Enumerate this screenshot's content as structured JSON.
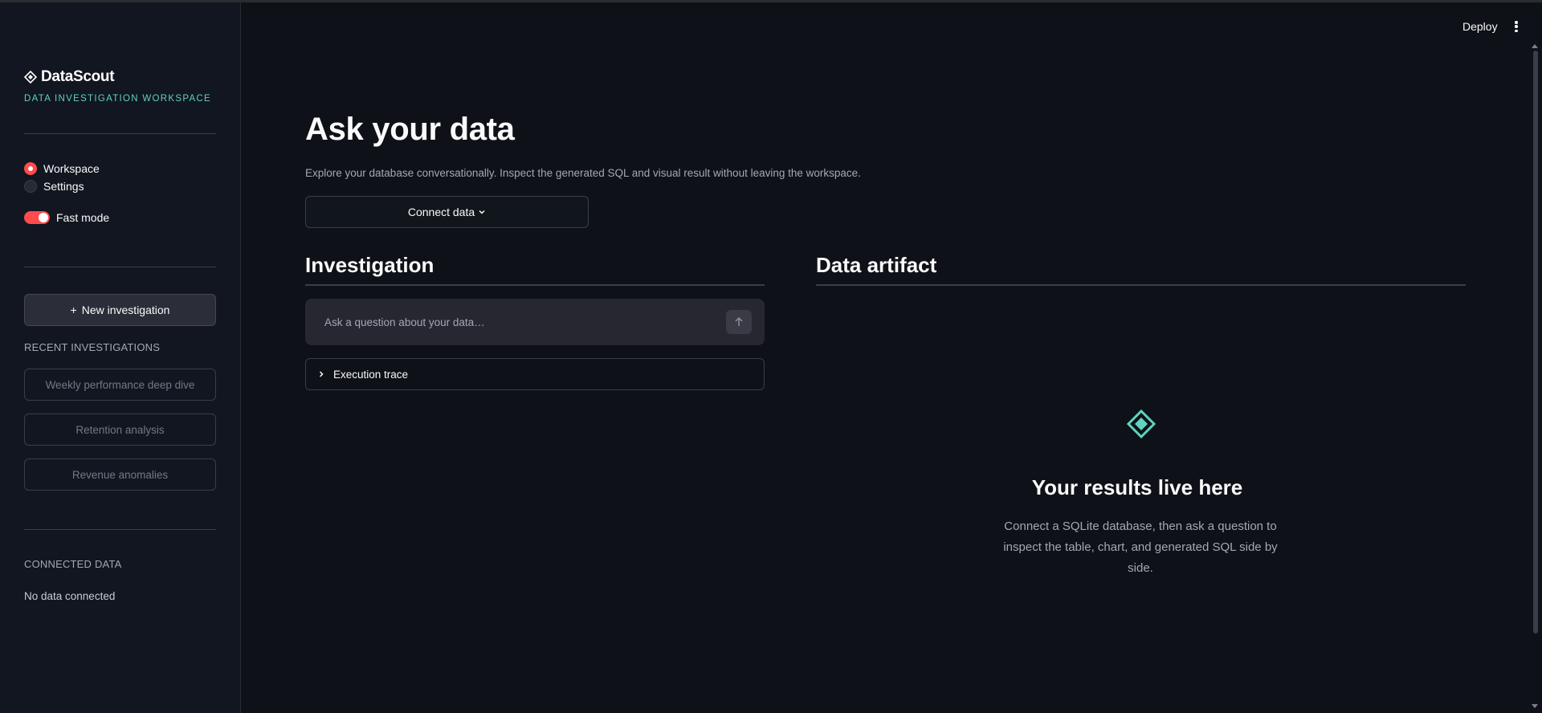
{
  "brand": {
    "name": "DataScout",
    "tagline": "DATA INVESTIGATION WORKSPACE",
    "icon": "diamond-logo-icon",
    "accent": "#5fd3bf"
  },
  "sidebar": {
    "nav": [
      {
        "label": "Workspace",
        "selected": true
      },
      {
        "label": "Settings",
        "selected": false
      }
    ],
    "fast_mode": {
      "label": "Fast mode",
      "on": true
    },
    "new_investigation": {
      "label": "New investigation",
      "icon": "plus"
    },
    "recent_label": "RECENT INVESTIGATIONS",
    "recent": [
      {
        "label": "Weekly performance deep dive"
      },
      {
        "label": "Retention analysis"
      },
      {
        "label": "Revenue anomalies"
      }
    ],
    "connected_label": "CONNECTED DATA",
    "connected_value": "No data connected"
  },
  "header": {
    "deploy_label": "Deploy",
    "menu_icon": "kebab-menu-icon"
  },
  "main": {
    "title": "Ask your data",
    "description": "Explore your database conversationally. Inspect the generated SQL and visual result without leaving the workspace.",
    "connect_button": "Connect data",
    "investigation": {
      "title": "Investigation",
      "input_placeholder": "Ask a question about your data…",
      "input_value": "",
      "trace_label": "Execution trace"
    },
    "artifact": {
      "title": "Data artifact",
      "empty_title": "Your results live here",
      "empty_text": "Connect a SQLite database, then ask a question to inspect the table, chart, and generated SQL side by side."
    }
  },
  "colors": {
    "toggle_on": "#ff4b4b",
    "background": "#0e1117",
    "sidebar": "#111620"
  }
}
